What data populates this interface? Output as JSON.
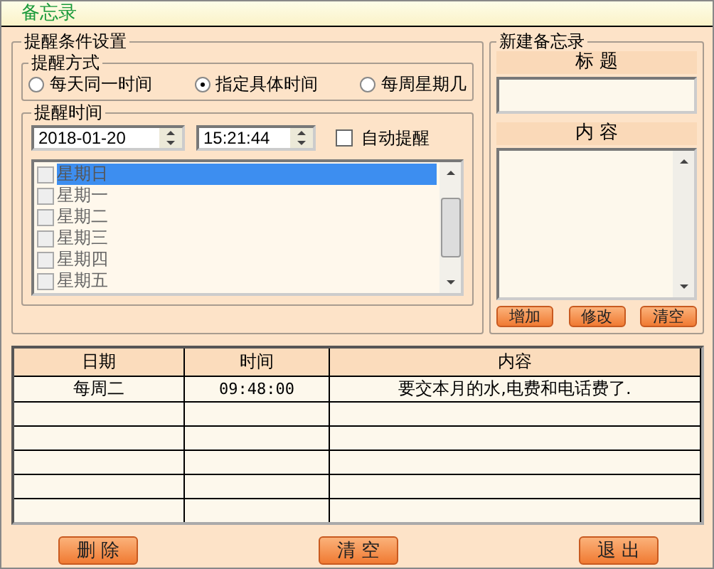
{
  "window": {
    "title": "备忘录"
  },
  "reminder_settings": {
    "title": "提醒条件设置",
    "mode": {
      "title": "提醒方式",
      "options": [
        {
          "label": "每天同一时间",
          "selected": false
        },
        {
          "label": "指定具体时间",
          "selected": true
        },
        {
          "label": "每周星期几",
          "selected": false
        }
      ]
    },
    "time": {
      "title": "提醒时间",
      "date": "2018-01-20",
      "clock": "15:21:44",
      "auto_remind": {
        "label": "自动提醒",
        "checked": false
      },
      "weekdays": [
        {
          "label": "星期日",
          "checked": false,
          "selected": true
        },
        {
          "label": "星期一",
          "checked": false,
          "selected": false
        },
        {
          "label": "星期二",
          "checked": false,
          "selected": false
        },
        {
          "label": "星期三",
          "checked": false,
          "selected": false
        },
        {
          "label": "星期四",
          "checked": false,
          "selected": false
        },
        {
          "label": "星期五",
          "checked": false,
          "selected": false
        }
      ]
    }
  },
  "new_memo": {
    "title": "新建备忘录",
    "title_label": "标 题",
    "content_label": "内 容",
    "buttons": [
      "增加",
      "修改",
      "清空"
    ]
  },
  "table": {
    "columns": [
      "日期",
      "时间",
      "内容"
    ],
    "rows": [
      [
        "每周二",
        "09:48:00",
        "要交本月的水,电费和电话费了."
      ]
    ]
  },
  "buttons": [
    "删 除",
    "清 空",
    "退 出"
  ]
}
